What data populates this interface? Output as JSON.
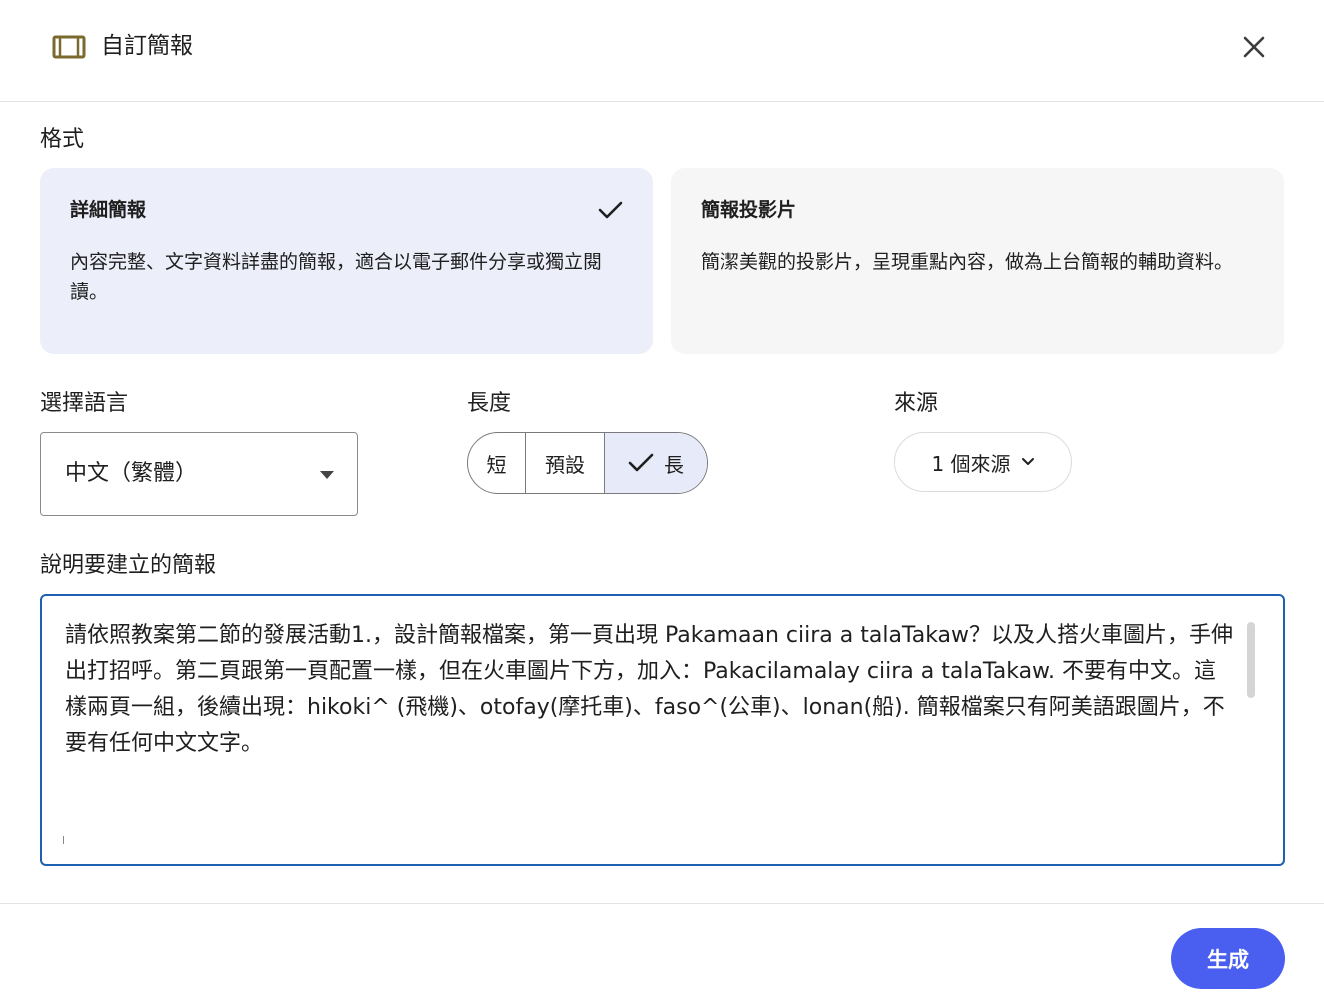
{
  "dialog": {
    "title": "自訂簡報",
    "icon": "slides-frame-icon",
    "accent_color": "#7a6a2e"
  },
  "format": {
    "label": "格式",
    "cards": [
      {
        "title": "詳細簡報",
        "description": "內容完整、文字資料詳盡的簡報，適合以電子郵件分享或獨立閱讀。",
        "selected": true
      },
      {
        "title": "簡報投影片",
        "description": "簡潔美觀的投影片，呈現重點內容，做為上台簡報的輔助資料。",
        "selected": false
      }
    ]
  },
  "language": {
    "label": "選擇語言",
    "value": "中文（繁體）"
  },
  "length": {
    "label": "長度",
    "options": [
      "短",
      "預設",
      "長"
    ],
    "selected": "長"
  },
  "source": {
    "label": "來源",
    "value": "1 個來源"
  },
  "description": {
    "label": "說明要建立的簡報",
    "value": "請依照教案第二節的發展活動1.，設計簡報檔案，第一頁出現 Pakamaan ciira a talaTakaw？以及人搭火車圖片，手伸出打招呼。第二頁跟第一頁配置一樣，但在火車圖片下方，加入：Pakacilamalay ciira a talaTakaw. 不要有中文。這樣兩頁一組，後續出現：hikoki^ (飛機)、otofay(摩托車)、faso^(公車)、lonan(船). 簡報檔案只有阿美語跟圖片，不要有任何中文文字。"
  },
  "footer": {
    "generate_label": "生成",
    "generate_color": "#4a5ef0"
  }
}
